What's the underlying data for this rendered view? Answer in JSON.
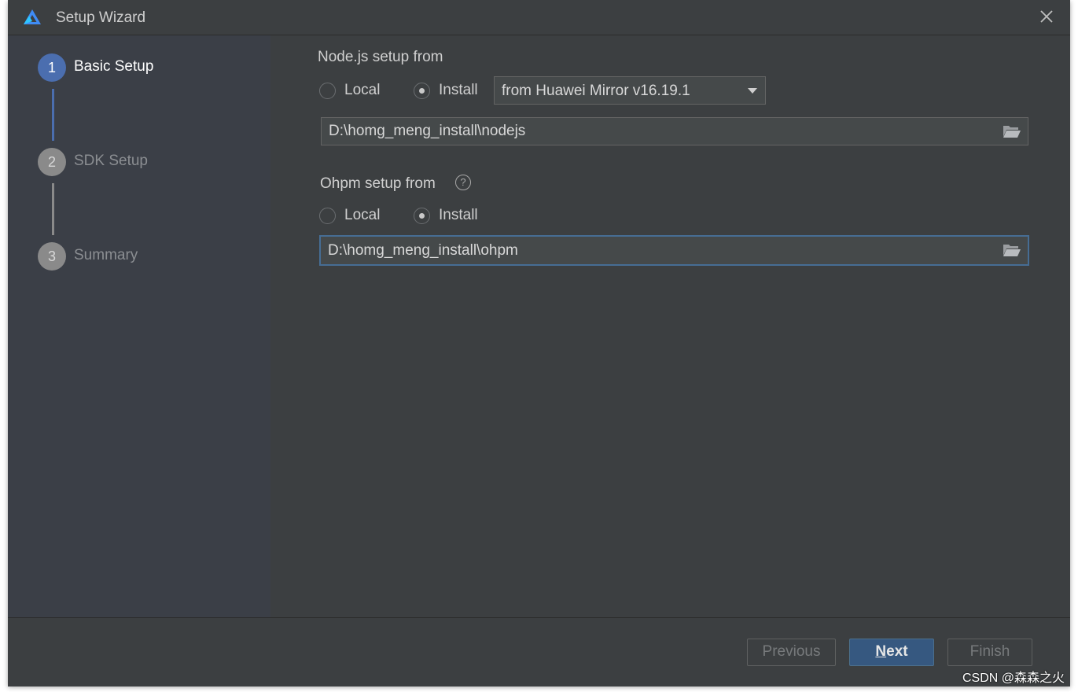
{
  "window": {
    "title": "Setup Wizard",
    "icon": "deveco-logo-icon"
  },
  "steps": [
    {
      "num": "1",
      "label": "Basic Setup",
      "state": "active"
    },
    {
      "num": "2",
      "label": "SDK Setup",
      "state": "inactive"
    },
    {
      "num": "3",
      "label": "Summary",
      "state": "inactive"
    }
  ],
  "nodejs": {
    "label": "Node.js setup from",
    "local_label": "Local",
    "install_label": "Install",
    "selected": "Install",
    "source": "from Huawei Mirror v16.19.1",
    "path": "D:\\homg_meng_install\\nodejs"
  },
  "ohpm": {
    "label": "Ohpm setup from",
    "help_glyph": "?",
    "local_label": "Local",
    "install_label": "Install",
    "selected": "Install",
    "path": "D:\\homg_meng_install\\ohpm"
  },
  "buttons": {
    "previous": "Previous",
    "next_mnemonic": "N",
    "next_rest": "ext",
    "finish": "Finish"
  },
  "watermark": "CSDN @森森之火",
  "colors": {
    "accent": "#4b6eaf",
    "primary_button": "#365880",
    "focus_border": "#466d94"
  }
}
